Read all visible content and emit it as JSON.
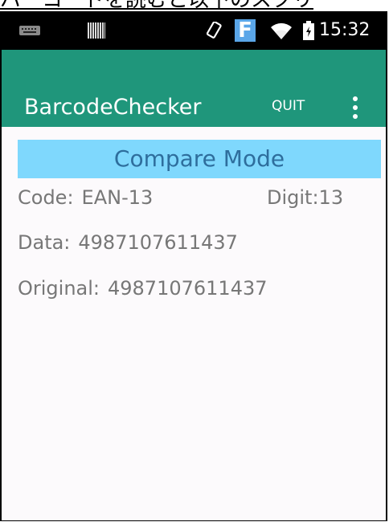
{
  "caption": {
    "text": "バーコードを読むと以下のスクリ"
  },
  "status_bar": {
    "time": "15:32",
    "icons": [
      "keyboard-icon",
      "barcode-icon",
      "screen-rotation-icon",
      "f-app-icon",
      "wifi-icon",
      "battery-icon"
    ],
    "f_label": "F"
  },
  "app_bar": {
    "title": "BarcodeChecker",
    "quit_label": "QUIT",
    "menu_icon": "more-vert-icon",
    "color": "#1f967b"
  },
  "content": {
    "mode_banner": "Compare Mode",
    "banner_color": "#7fd8fd",
    "code_label": "Code:",
    "code_value": "EAN-13",
    "digit_label": "Digit:",
    "digit_value": "13",
    "data_label": "Data:",
    "data_value": "4987107611437",
    "original_label": "Original:",
    "original_value": "4987107611437"
  }
}
